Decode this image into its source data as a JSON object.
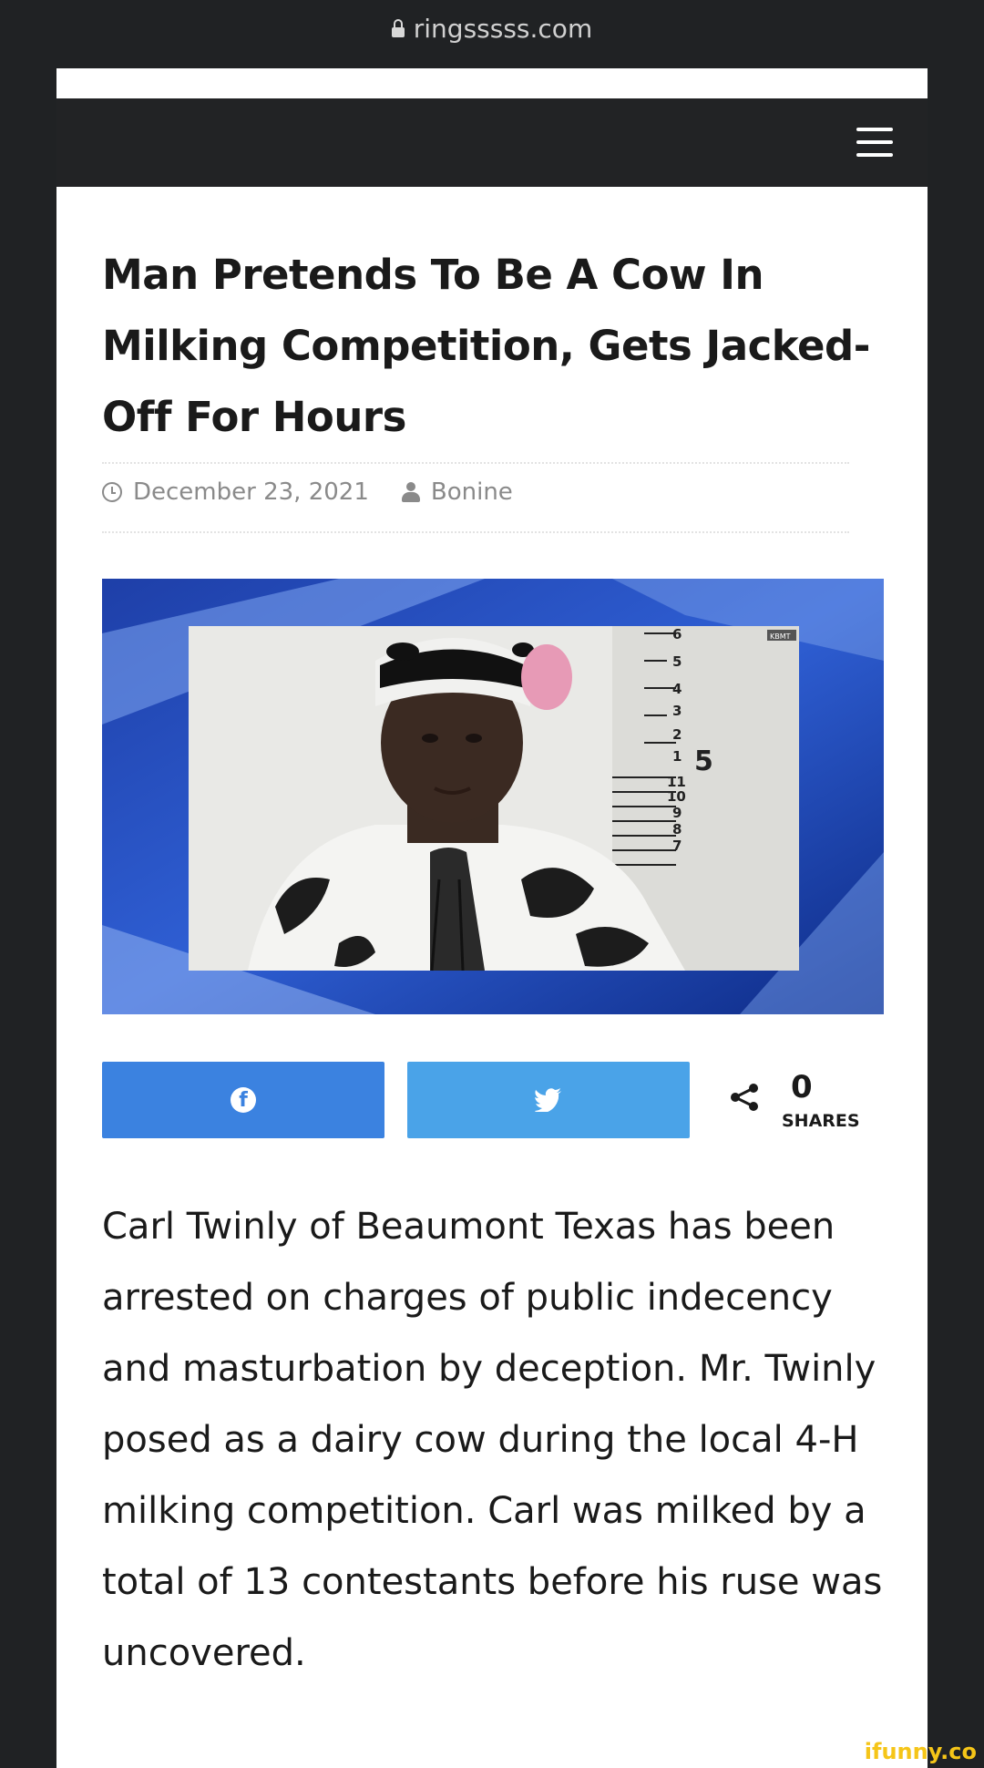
{
  "browser": {
    "url": "ringsssss.com",
    "lock_icon": "lock-icon"
  },
  "header": {
    "menu_icon": "hamburger-menu-icon",
    "background": "#222325"
  },
  "article": {
    "title": "Man Pretends To Be A Cow In Milking Competition, Gets Jacked-Off For Hours",
    "date": "December 23, 2021",
    "author": "Bonine",
    "date_icon": "clock-icon",
    "author_icon": "user-icon",
    "image": {
      "description_icon": "mugshot-photo",
      "height_chart_labels": [
        "6",
        "5",
        "4",
        "3",
        "2",
        "1",
        "5",
        "11",
        "10",
        "9",
        "8",
        "7"
      ],
      "tv_badge": "KBMT"
    },
    "body": "Carl Twinly of Beaumont Texas has been arrested on charges of public indecency and masturbation by deception. Mr. Twinly posed as a dairy cow during the local 4-H milking competition. Carl was milked by a total of 13 contestants before his ruse was uncovered."
  },
  "share": {
    "facebook_icon": "facebook-icon",
    "twitter_icon": "twitter-icon",
    "share_icon": "share-icon",
    "count": "0",
    "label": "SHARES",
    "colors": {
      "facebook": "#3b82e0",
      "twitter": "#4aa3e8"
    }
  },
  "watermark": {
    "text": "ifunny.co",
    "color": "#f5c518"
  }
}
